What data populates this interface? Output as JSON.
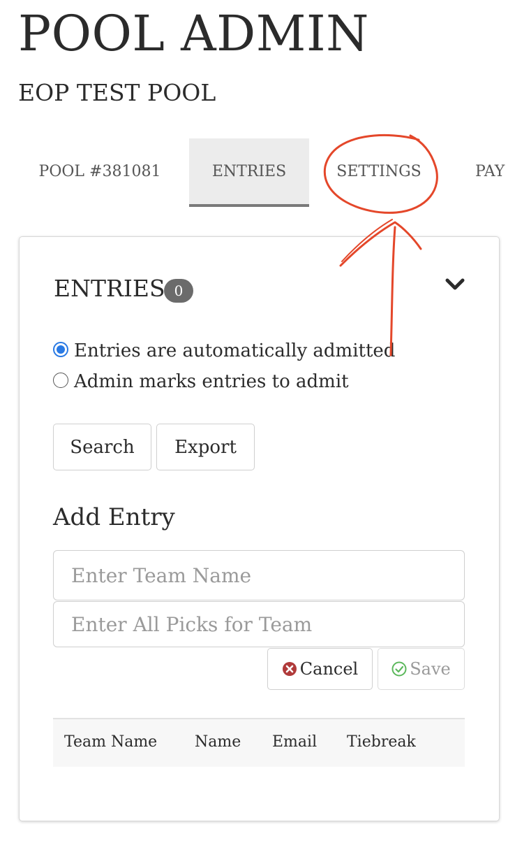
{
  "header": {
    "title": "POOL ADMIN",
    "pool_name": "EOP TEST POOL"
  },
  "tabs": [
    {
      "label": "POOL #381081",
      "active": false
    },
    {
      "label": "ENTRIES",
      "active": true
    },
    {
      "label": "SETTINGS",
      "active": false
    },
    {
      "label": "PAY",
      "active": false
    }
  ],
  "entries_panel": {
    "title": "ENTRIES",
    "count": "0",
    "collapse_icon": "chevron-down-icon",
    "admission_options": [
      {
        "label": "Entries are automatically admitted",
        "selected": true
      },
      {
        "label": "Admin marks entries to admit",
        "selected": false
      }
    ],
    "search_label": "Search",
    "export_label": "Export"
  },
  "add_entry": {
    "title": "Add Entry",
    "team_name_placeholder": "Enter Team Name",
    "picks_placeholder": "Enter All Picks for Team",
    "cancel_label": "Cancel",
    "cancel_icon": "x-circle-icon",
    "save_label": "Save",
    "save_icon": "check-circle-icon"
  },
  "table": {
    "columns": [
      "Team Name",
      "Name",
      "Email",
      "Tiebreak"
    ]
  },
  "colors": {
    "accent_radio": "#2a7ae4",
    "annotation": "#e4472a",
    "cancel_icon": "#b03a3a",
    "save_icon": "#5cb85c",
    "badge": "#6b6b6b"
  }
}
